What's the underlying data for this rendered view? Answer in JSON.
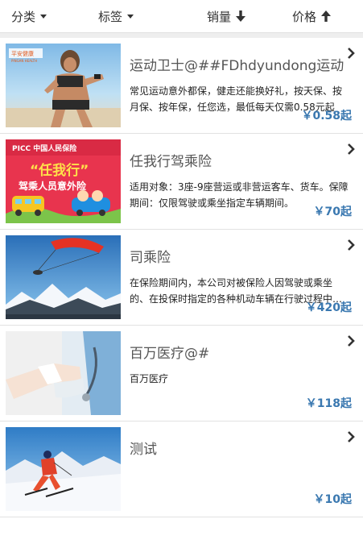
{
  "filters": {
    "category": "分类",
    "tags": "标签",
    "sales": "销量",
    "price": "价格"
  },
  "items": [
    {
      "title": "运动卫士@##FDhdyundong运动",
      "desc": "常见运动意外都保，健走还能换好礼，按天保、按月保、按年保，任您选，最低每天仅需0.58元起",
      "price": "￥0.58起",
      "thumb_brand": "平安健康",
      "thumb_brand_sub": "PINGAN HEALTH"
    },
    {
      "title": "任我行驾乘险",
      "desc": "适用对象：3座-9座营运或非营运客车、货车。保障期间：仅限驾驶或乘坐指定车辆期间。",
      "price": "￥70起",
      "thumb_brand": "PICC 中国人民保险",
      "thumb_line1": "“任我行”",
      "thumb_line2": "驾乘人员意外险"
    },
    {
      "title": "司乘险",
      "desc": "在保险期间内，本公司对被保险人因驾驶或乘坐的、在投保时指定的各种机动车辆在行驶过程中发生意外",
      "price": "￥420起"
    },
    {
      "title": "百万医疗@#",
      "desc": "百万医疗",
      "price": "￥118起"
    },
    {
      "title": "测试",
      "desc": "",
      "price": "￥10起"
    }
  ]
}
